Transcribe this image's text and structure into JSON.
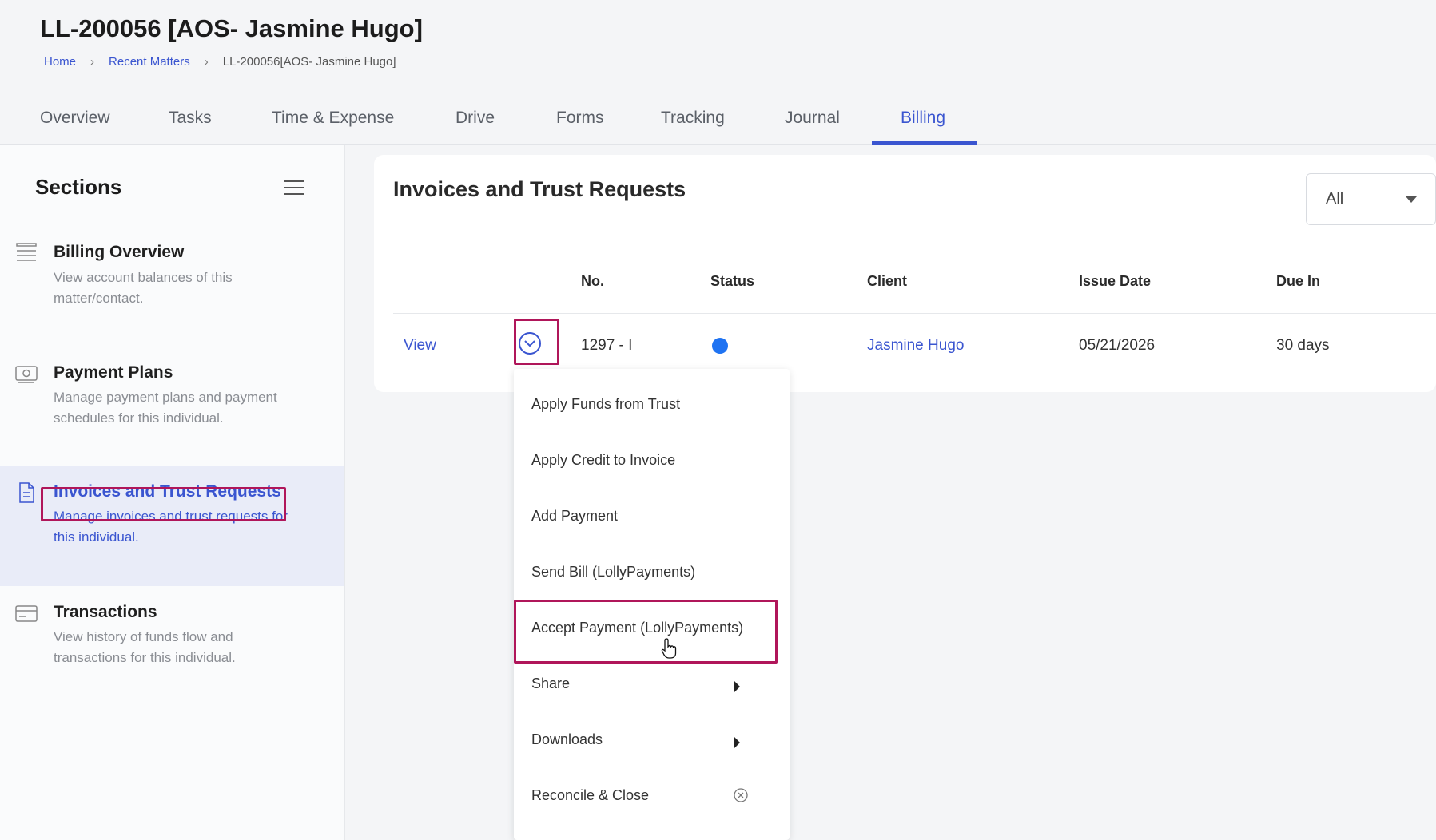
{
  "page": {
    "title": "LL-200056 [AOS- Jasmine Hugo]",
    "breadcrumb": [
      "Home",
      "Recent Matters",
      "LL-200056[AOS- Jasmine Hugo]"
    ]
  },
  "tabs": [
    "Overview",
    "Tasks",
    "Time & Expense",
    "Drive",
    "Forms",
    "Tracking",
    "Journal",
    "Billing"
  ],
  "active_tab": "Billing",
  "sidebar": {
    "title": "Sections",
    "items": [
      {
        "title": "Billing Overview",
        "desc_line1": "View account balances of this",
        "desc_line2": "matter/contact."
      },
      {
        "title": "Payment Plans",
        "desc_line1": "Manage payment plans and payment",
        "desc_line2": "schedules for this individual."
      },
      {
        "title": "Invoices and Trust Requests",
        "desc_line1": "Manage invoices and trust requests for",
        "desc_line2": "this individual."
      },
      {
        "title": "Transactions",
        "desc_line1": "View history of funds flow and",
        "desc_line2": "transactions for this individual."
      }
    ]
  },
  "main": {
    "title": "Invoices and Trust Requests",
    "filter": "All",
    "columns": [
      "No.",
      "Status",
      "Client",
      "Issue Date",
      "Due In"
    ],
    "rows": [
      {
        "action": "View",
        "no": "1297 - I",
        "client": "Jasmine Hugo",
        "issue_date": "05/21/2026",
        "due_in": "30 days"
      }
    ]
  },
  "dropdown": {
    "items": [
      "Apply Funds from Trust",
      "Apply Credit to Invoice",
      "Add Payment",
      "Send Bill (LollyPayments)",
      "Accept Payment (LollyPayments)",
      "Share",
      "Downloads",
      "Reconcile & Close"
    ]
  },
  "colors": {
    "accent": "#3a55d0",
    "highlight": "#b0165a",
    "status_dot": "#1f73f2"
  }
}
